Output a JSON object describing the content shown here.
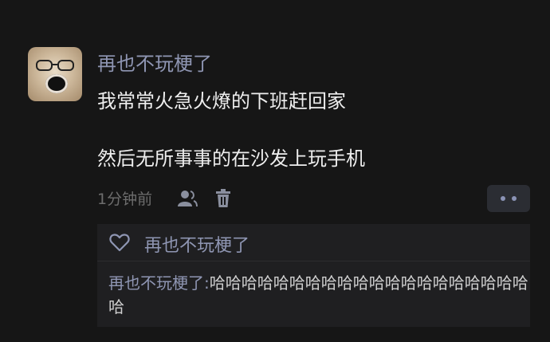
{
  "post": {
    "username": "再也不玩梗了",
    "line1": "我常常火急火燎的下班赶回家",
    "line2": "然后无所事事的在沙发上玩手机",
    "time": "1分钟前"
  },
  "reply_section": {
    "liked_by": "再也不玩梗了",
    "reply_author": "再也不玩梗了:",
    "reply_text": "哈哈哈哈哈哈哈哈哈哈哈哈哈哈哈哈哈哈哈哈哈"
  },
  "icons": {
    "user": "user-icon",
    "trash": "trash-icon",
    "more": "more-dots-icon",
    "heart": "heart-outline-icon"
  },
  "colors": {
    "background": "#161616",
    "username": "#8f96b3",
    "content": "#eeeeee",
    "meta": "#6d6d6d",
    "reply_bg": "#1f1f21",
    "more_btn_bg": "#2b2d33"
  }
}
